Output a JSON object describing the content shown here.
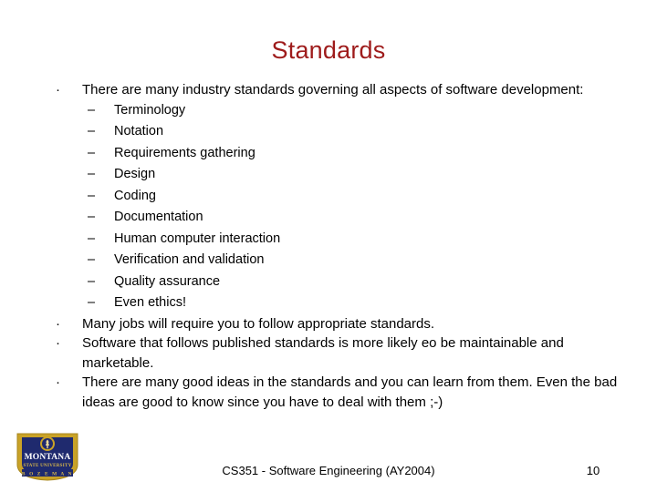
{
  "slide": {
    "title": "Standards",
    "bullets": [
      {
        "level": 1,
        "text": "There are many industry standards governing all aspects of software development:"
      },
      {
        "level": 2,
        "text": "Terminology"
      },
      {
        "level": 2,
        "text": "Notation"
      },
      {
        "level": 2,
        "text": "Requirements gathering"
      },
      {
        "level": 2,
        "text": "Design"
      },
      {
        "level": 2,
        "text": "Coding"
      },
      {
        "level": 2,
        "text": "Documentation"
      },
      {
        "level": 2,
        "text": "Human computer interaction"
      },
      {
        "level": 2,
        "text": "Verification and validation"
      },
      {
        "level": 2,
        "text": "Quality assurance"
      },
      {
        "level": 2,
        "text": "Even ethics!"
      },
      {
        "level": 1,
        "text": "Many jobs will require you to follow appropriate standards."
      },
      {
        "level": 1,
        "text": "Software that follows published standards is more likely eo be maintainable and marketable."
      },
      {
        "level": 1,
        "text": "There are many good ideas in the standards and you can learn from them. Even the bad ideas are good to know since you have to deal with them ;-)"
      }
    ],
    "markers": {
      "level1": "·",
      "level2": "–"
    }
  },
  "footer": {
    "course": "CS351 - Software Engineering (AY2004)",
    "page_number": "10"
  },
  "logo": {
    "name": "montana-state-university-logo",
    "line1": "MONTANA",
    "line2": "STATE UNIVERSITY",
    "line3": "B O Z E M A N",
    "border_color": "#C9A227",
    "field_color": "#1F2A6E",
    "text_color": "#FFFFFF",
    "accent_color": "#D8B84A"
  },
  "colors": {
    "title": "#9E1B1B",
    "body_text": "#000000",
    "background": "#FFFFFF"
  }
}
